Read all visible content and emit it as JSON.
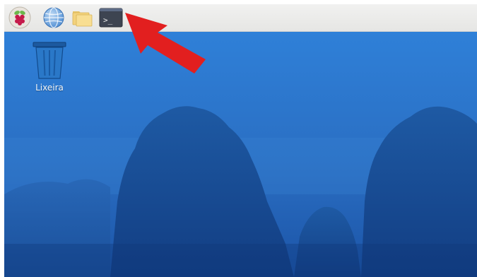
{
  "taskbar": {
    "items": [
      {
        "name": "raspberry-menu",
        "icon": "raspberry-icon"
      },
      {
        "name": "web-browser",
        "icon": "globe-icon"
      },
      {
        "name": "file-manager",
        "icon": "folder-icon"
      },
      {
        "name": "terminal",
        "icon": "terminal-icon",
        "glyph": ">_"
      }
    ]
  },
  "desktop": {
    "trash": {
      "label": "Lixeira",
      "icon": "trash-icon"
    }
  },
  "annotation": {
    "icon": "red-arrow-icon",
    "points_to": "terminal",
    "color": "#e21f1f"
  },
  "colors": {
    "panel": "#ececea",
    "wallpaper_top": "#2e7ed6",
    "wallpaper_bottom": "#1a55a8"
  }
}
